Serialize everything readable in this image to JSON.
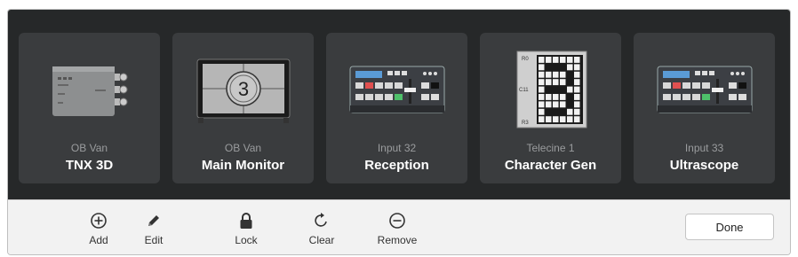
{
  "devices": [
    {
      "subtitle": "OB Van",
      "title": "TNX 3D",
      "icon": "converter-box-icon"
    },
    {
      "subtitle": "OB Van",
      "title": "Main Monitor",
      "icon": "monitor-countdown-icon",
      "display_digit": "3"
    },
    {
      "subtitle": "Input 32",
      "title": "Reception",
      "icon": "switcher-panel-icon"
    },
    {
      "subtitle": "Telecine 1",
      "title": "Character Gen",
      "icon": "character-grid-icon",
      "grid_labels": [
        "R0",
        "C11",
        "R3"
      ]
    },
    {
      "subtitle": "Input 33",
      "title": "Ultrascope",
      "icon": "switcher-panel-icon"
    }
  ],
  "toolbar": {
    "add_label": "Add",
    "edit_label": "Edit",
    "lock_label": "Lock",
    "clear_label": "Clear",
    "remove_label": "Remove",
    "done_label": "Done"
  },
  "colors": {
    "panel_bg": "#262829",
    "card_bg": "#3a3c3e",
    "toolbar_bg": "#f2f2f2"
  }
}
